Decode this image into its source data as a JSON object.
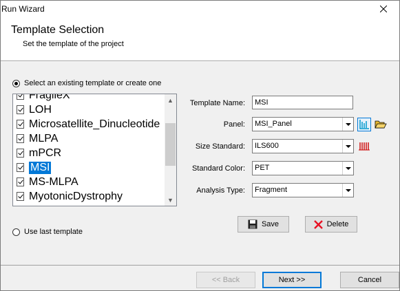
{
  "window": {
    "title": "Run Wizard"
  },
  "header": {
    "title": "Template Selection",
    "subtitle": "Set the template of the project"
  },
  "options": {
    "existing_label": "Select an existing template or create one",
    "last_label": "Use last template"
  },
  "templates": [
    {
      "label": "FragileX",
      "checked": true,
      "selected": false
    },
    {
      "label": "LOH",
      "checked": true,
      "selected": false
    },
    {
      "label": "Microsatellite_Dinucleotide",
      "checked": true,
      "selected": false
    },
    {
      "label": "MLPA",
      "checked": true,
      "selected": false
    },
    {
      "label": "mPCR",
      "checked": true,
      "selected": false
    },
    {
      "label": "MSI",
      "checked": true,
      "selected": true
    },
    {
      "label": "MS-MLPA",
      "checked": true,
      "selected": false
    },
    {
      "label": "MyotonicDystrophy",
      "checked": true,
      "selected": false
    }
  ],
  "form": {
    "template_name_label": "Template Name:",
    "template_name_value": "MSI",
    "panel_label": "Panel:",
    "panel_value": "MSI_Panel",
    "size_standard_label": "Size Standard:",
    "size_standard_value": "ILS600",
    "standard_color_label": "Standard Color:",
    "standard_color_value": "PET",
    "analysis_type_label": "Analysis Type:",
    "analysis_type_value": "Fragment"
  },
  "actions": {
    "save_label": "Save",
    "delete_label": "Delete"
  },
  "nav": {
    "back_label": "<< Back",
    "next_label": "Next >>",
    "cancel_label": "Cancel"
  },
  "colors": {
    "selection": "#0078d7",
    "delete_icon": "#e81123",
    "panel_icon": "#0099cc",
    "size_icon": "#cc0000",
    "folder_icon": "#e8b830"
  }
}
